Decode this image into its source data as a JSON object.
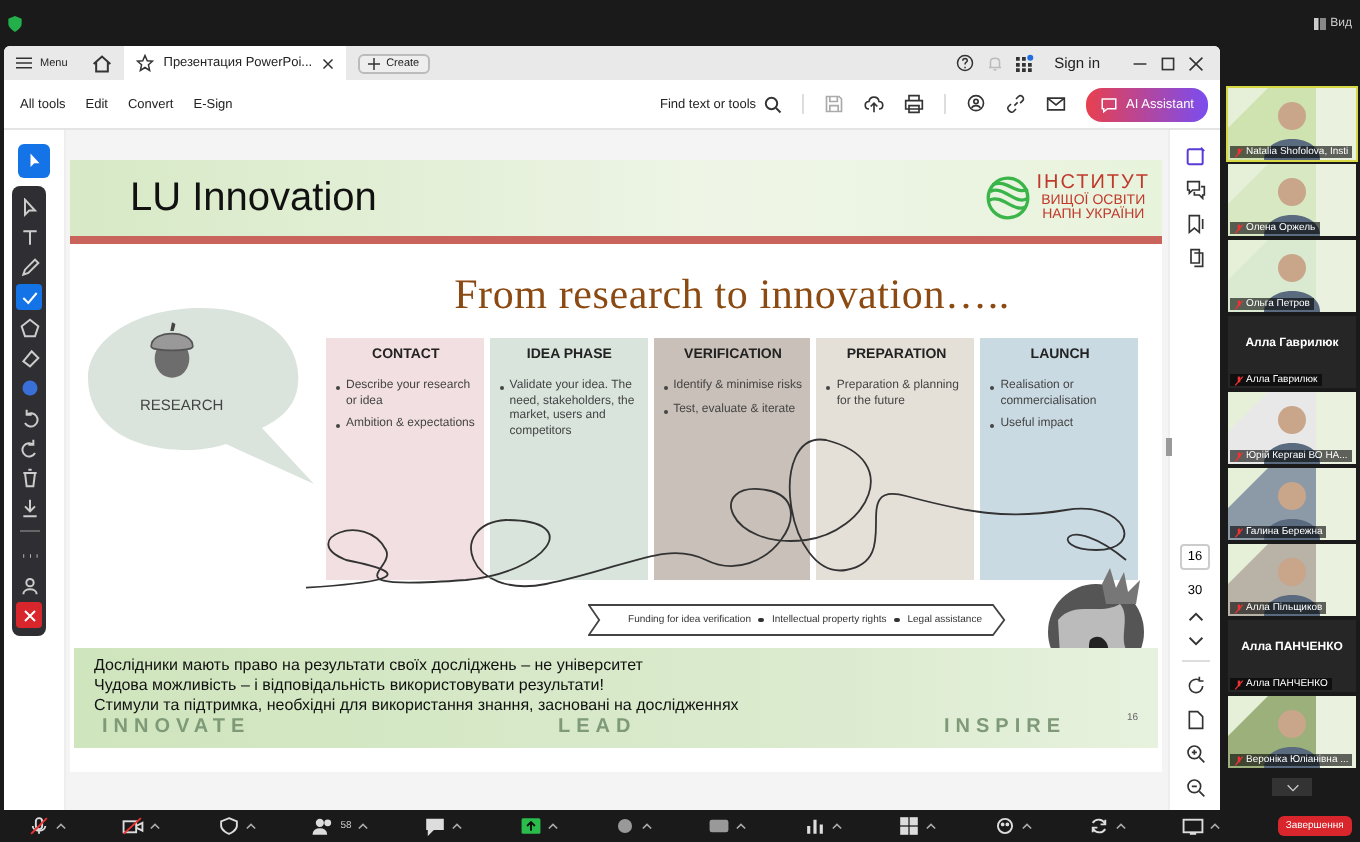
{
  "zoom_top": {
    "view_label": "Вид"
  },
  "acrobat": {
    "menu": "Menu",
    "tabs": [
      {
        "label": "Презентация PowerPoi...",
        "selected": true
      }
    ],
    "create": "Create",
    "sign_in": "Sign in",
    "toolbar": [
      "All tools",
      "Edit",
      "Convert",
      "E-Sign"
    ],
    "find": "Find text or tools",
    "ai_button": "AI Assistant",
    "select_tool_selected": true,
    "page_number": "16",
    "page_count": "30"
  },
  "annotation_tools": [
    {
      "kind": "pointer",
      "selected": false
    },
    {
      "kind": "text",
      "selected": false
    },
    {
      "kind": "pen",
      "selected": false
    },
    {
      "kind": "check",
      "selected": true
    },
    {
      "kind": "shape",
      "selected": false
    },
    {
      "kind": "eraser",
      "selected": false
    },
    {
      "kind": "color",
      "selected": false
    },
    {
      "kind": "undo",
      "selected": false
    },
    {
      "kind": "redo",
      "selected": false
    },
    {
      "kind": "delete",
      "selected": false
    },
    {
      "kind": "download",
      "selected": false
    },
    {
      "kind": "more",
      "selected": false
    },
    {
      "kind": "person",
      "selected": false
    },
    {
      "kind": "close"
    }
  ],
  "slide": {
    "title": "LU Innovation",
    "logo_lines": [
      "ІНСТИТУТ",
      "ВИЩОЇ ОСВІТИ",
      "НАПН УКРАЇНИ"
    ],
    "heading": "From research to innovation…..",
    "research_label": "RESEARCH",
    "columns": [
      {
        "title": "CONTACT",
        "color": "#f2dfe1",
        "bullets": [
          "Describe your research or idea",
          "Ambition & expectations"
        ]
      },
      {
        "title": "IDEA PHASE",
        "color": "#d8e4dc",
        "bullets": [
          "Validate your idea. The need, stakeholders, the market, users and competitors"
        ]
      },
      {
        "title": "VERIFICATION",
        "color": "#c8c0b9",
        "bullets": [
          "Identify & minimise risks",
          "Test, evaluate & iterate"
        ]
      },
      {
        "title": "PREPARATION",
        "color": "#e4e0d8",
        "bullets": [
          "Preparation & planning for the future"
        ]
      },
      {
        "title": "LAUNCH",
        "color": "#cadae3",
        "bullets": [
          "Realisation  or commercialisation",
          "Useful impact"
        ]
      }
    ],
    "banner": [
      "Funding for idea verification",
      "Intellectual property rights",
      "Legal assistance"
    ],
    "notes": [
      "Дослідники мають право на результати своїх досліджень – не університет",
      "Чудова можливість – і відповідальність використовувати результати!",
      "Стимули та підтримка, необхідні для використання знання, засновані на дослідженнях"
    ],
    "footer_words": [
      "INNOVATE",
      "LEAD",
      "INSPIRE"
    ],
    "slide_number": "16"
  },
  "participants": [
    {
      "kind": "video",
      "name": "Natalia Shofolova, Insti",
      "active": true
    },
    {
      "kind": "video",
      "name": "Олена Оржель",
      "active": false
    },
    {
      "kind": "video",
      "name": "Ольга Петров",
      "active": false
    },
    {
      "kind": "name",
      "display": "Алла Гаврилюк",
      "name": "Алла Гаврилюк",
      "active": false
    },
    {
      "kind": "video",
      "name": "Юрій Кергаві ВО НА...",
      "active": false
    },
    {
      "kind": "video",
      "name": "Галина Бережна",
      "active": false
    },
    {
      "kind": "video",
      "name": "Алла Пільщиков",
      "active": false
    },
    {
      "kind": "name",
      "display": "Алла ПАНЧЕНКО",
      "name": "Алла ПАНЧЕНКО",
      "active": false
    },
    {
      "kind": "video",
      "name": "Вероніка Юліанівна ...",
      "active": false
    }
  ],
  "zoom_toolbar": {
    "items": [
      {
        "kind": "mic"
      },
      {
        "kind": "video"
      },
      {
        "kind": "security"
      },
      {
        "kind": "participants",
        "count": "58"
      },
      {
        "kind": "chat"
      },
      {
        "kind": "share"
      },
      {
        "kind": "record"
      },
      {
        "kind": "captions"
      },
      {
        "kind": "poll"
      },
      {
        "kind": "apps"
      },
      {
        "kind": "reactions"
      },
      {
        "kind": "refresh"
      },
      {
        "kind": "view"
      }
    ],
    "end_label": "Завершення"
  }
}
